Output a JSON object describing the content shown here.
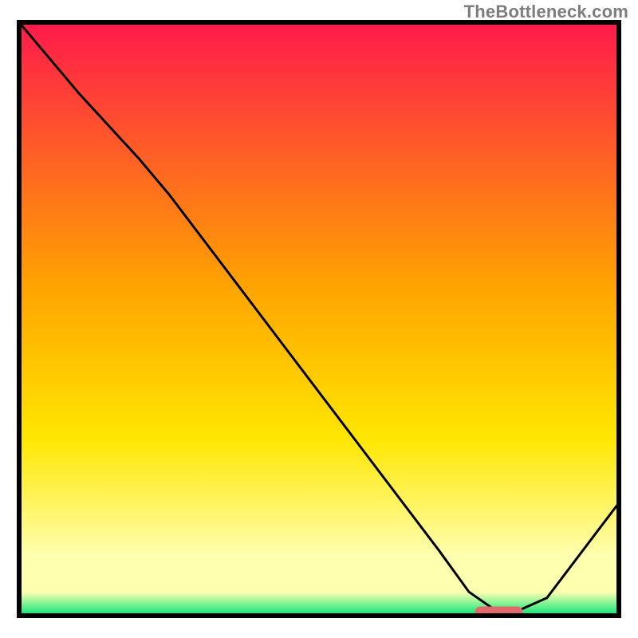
{
  "attribution": "TheBottleneck.com",
  "chart_data": {
    "type": "line",
    "title": "",
    "xlabel": "",
    "ylabel": "",
    "xlim": [
      0,
      100
    ],
    "ylim": [
      0,
      100
    ],
    "colors": {
      "gradient_top": "#ff1a4b",
      "gradient_mid_high": "#ffa500",
      "gradient_mid_low": "#ffe600",
      "gradient_soft": "#ffffb0",
      "gradient_bottom": "#00e676",
      "curve": "#000000",
      "marker_fill": "#e2696b",
      "frame": "#000000"
    },
    "series": [
      {
        "name": "bottleneck-curve",
        "x": [
          0.0,
          10.0,
          20.0,
          25.0,
          40.0,
          55.0,
          70.0,
          75.0,
          80.0,
          82.0,
          88.0,
          100.0
        ],
        "y": [
          100.0,
          88.0,
          77.0,
          71.0,
          51.0,
          31.0,
          11.0,
          4.0,
          0.5,
          0.3,
          3.0,
          19.0
        ]
      }
    ],
    "marker": {
      "name": "optimal-range",
      "x_start": 76.0,
      "x_end": 84.0,
      "y": 0.6
    }
  }
}
